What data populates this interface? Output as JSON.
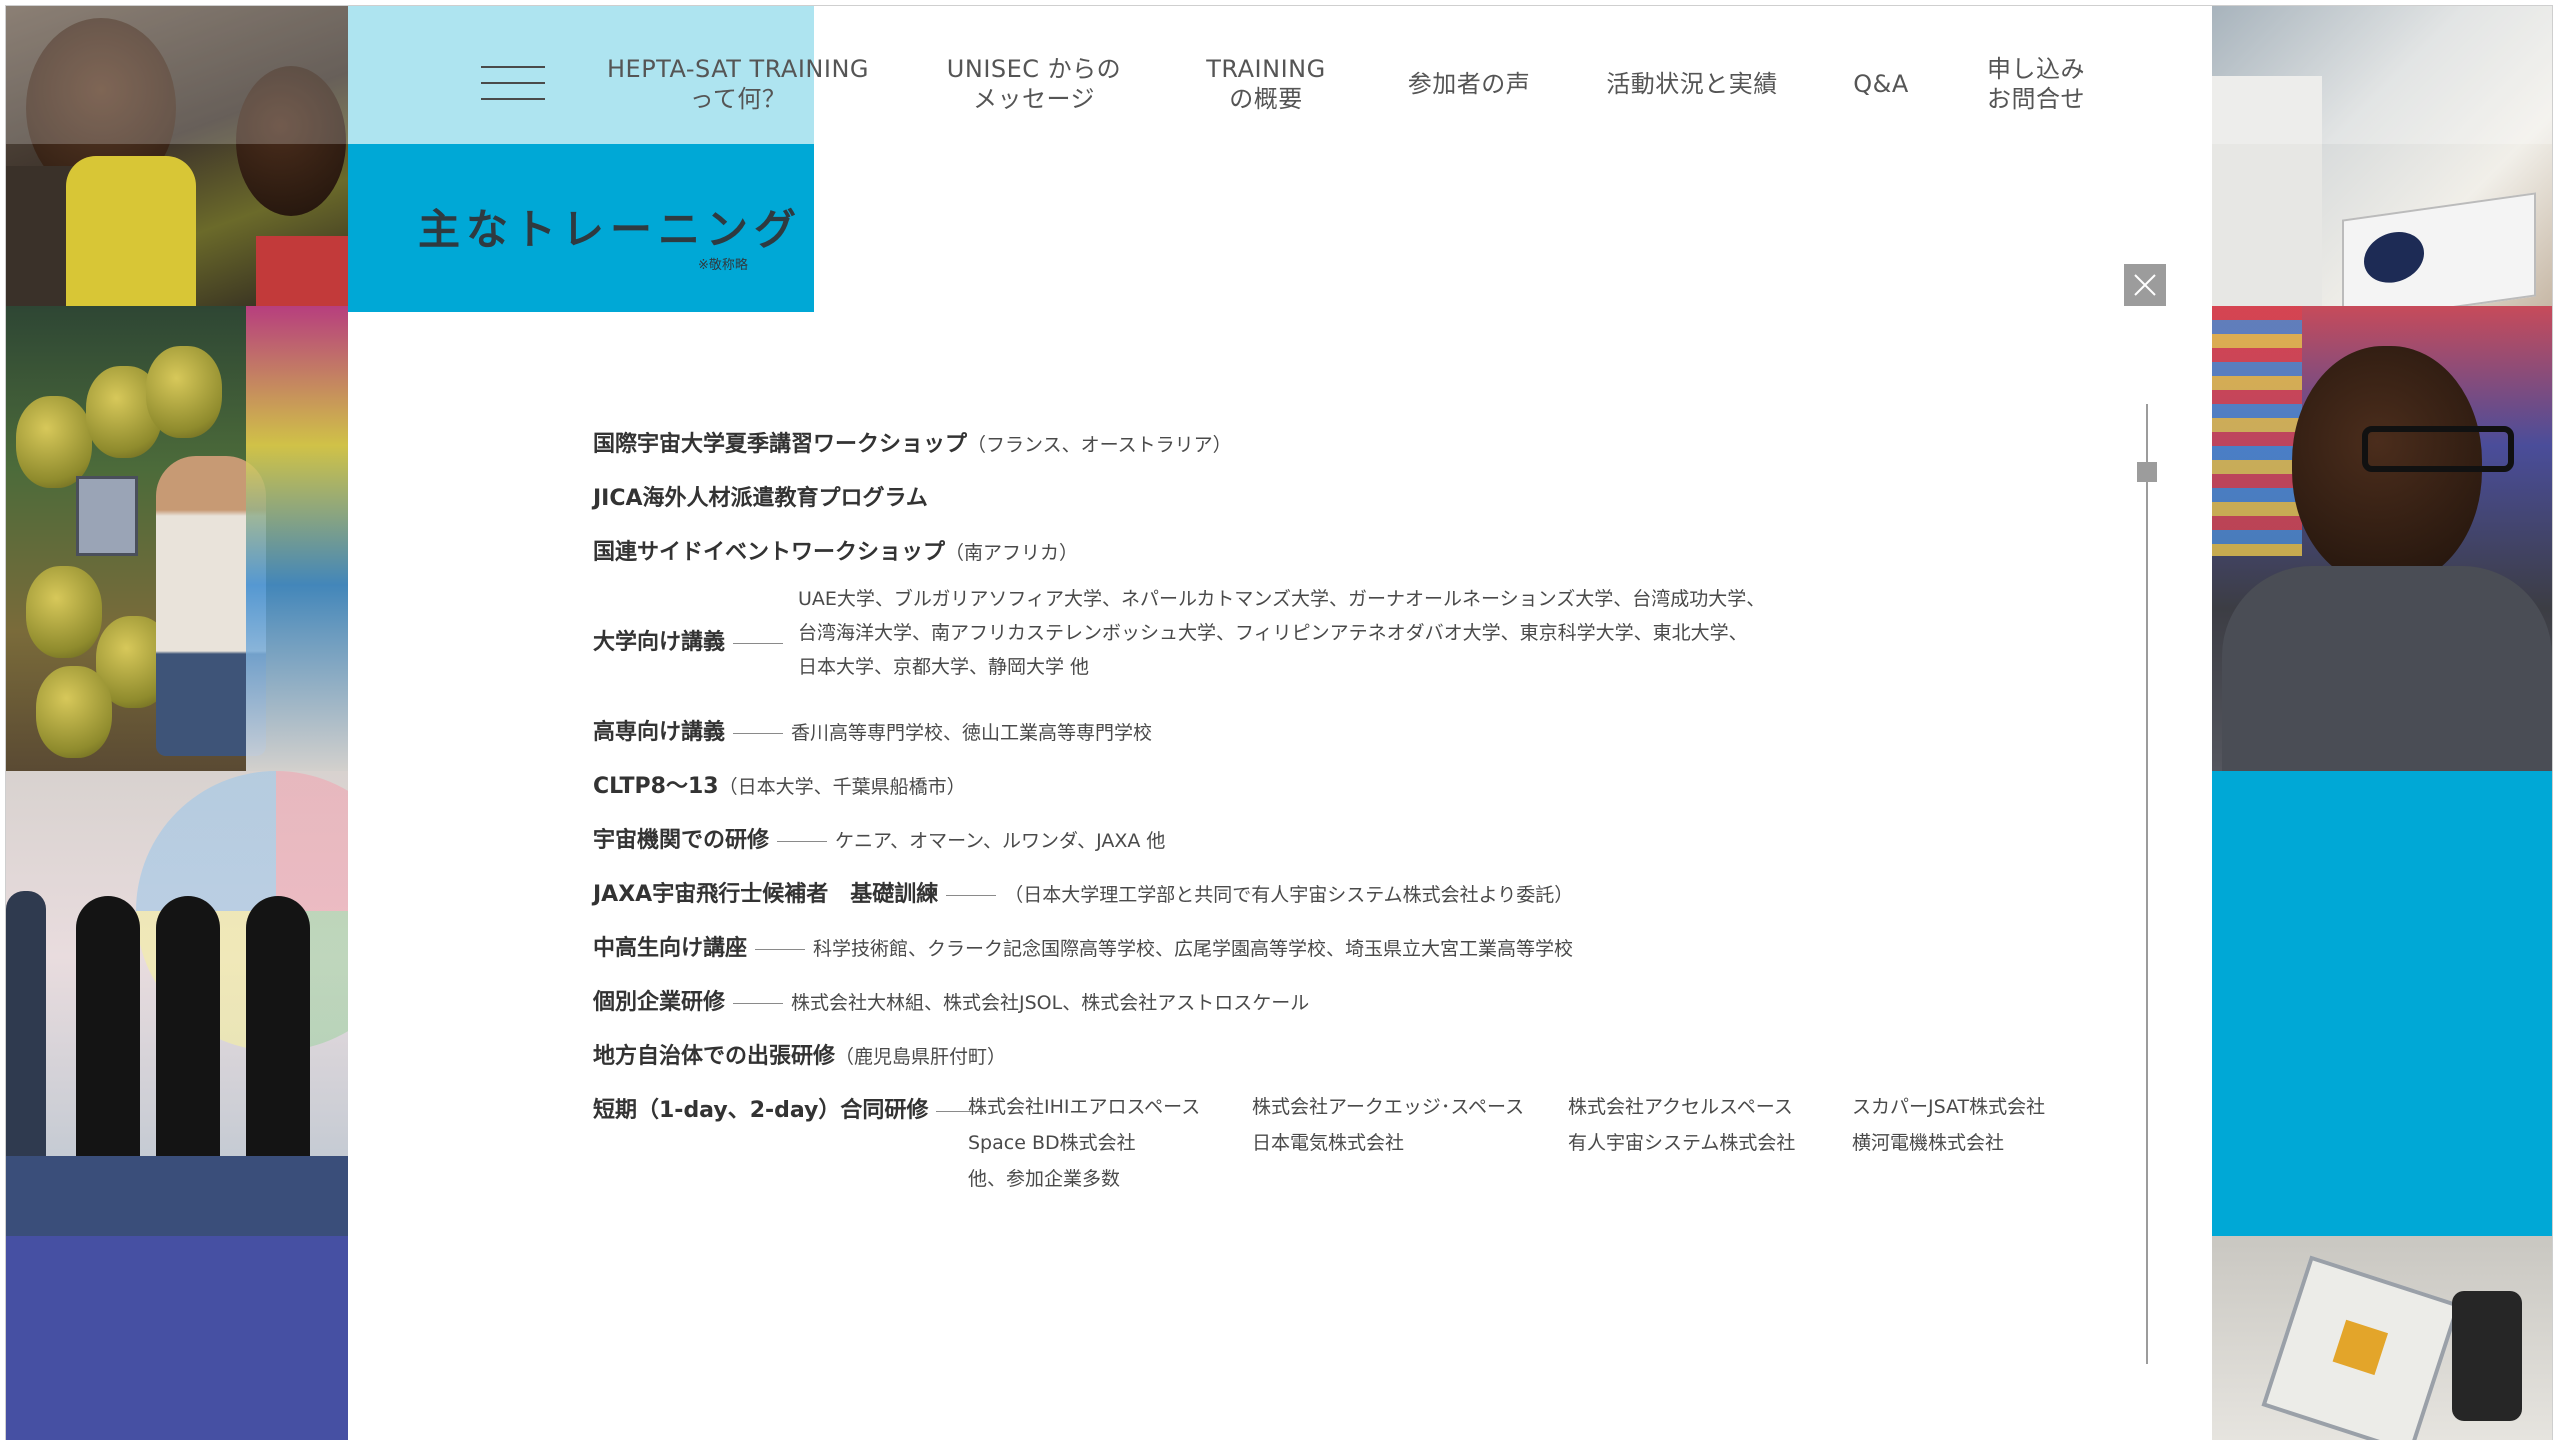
{
  "nav": {
    "items": [
      {
        "line1": "HEPTA-SAT TRAINING",
        "line2": "って何？"
      },
      {
        "line1": "UNISEC からの",
        "line2": "メッセージ"
      },
      {
        "line1": "TRAINING",
        "line2": "の概要"
      },
      {
        "line1": "参加者の声",
        "line2": ""
      },
      {
        "line1": "活動状況と実績",
        "line2": ""
      },
      {
        "line1": "Q&A",
        "line2": ""
      },
      {
        "line1": "申し込み",
        "line2": "お問合せ"
      }
    ]
  },
  "page": {
    "title": "主なトレーニング",
    "note": "※敬称略"
  },
  "trainings": [
    {
      "label": "国際宇宙大学夏季講習ワークショップ",
      "detail": "（フランス、オーストラリア）"
    },
    {
      "label": "JICA海外人材派遣教育プログラム",
      "detail": ""
    },
    {
      "label": "国連サイドイベントワークショップ",
      "detail": "（南アフリカ）"
    },
    {
      "label": "大学向け講義",
      "lines": [
        "UAE大学、ブルガリアソフィア大学、ネパールカトマンズ大学、ガーナオールネーションズ大学、台湾成功大学、",
        "台湾海洋大学、南アフリカステレンボッシュ大学、フィリピンアテネオダバオ大学、東京科学大学、東北大学、",
        "日本大学、京都大学、静岡大学 他"
      ]
    },
    {
      "label": "高専向け講義",
      "detail": "香川高等専門学校、徳山工業高等専門学校"
    },
    {
      "label": "CLTP8〜13",
      "detail": "（日本大学、千葉県船橋市）"
    },
    {
      "label": "宇宙機関での研修",
      "detail": "ケニア、オマーン、ルワンダ、JAXA 他"
    },
    {
      "label": "JAXA宇宙飛行士候補者　基礎訓練",
      "detail": "（日本大学理工学部と共同で有人宇宙システム株式会社より委託）"
    },
    {
      "label": "中高生向け講座",
      "detail": "科学技術館、クラーク記念国際高等学校、広尾学園高等学校、埼玉県立大宮工業高等学校"
    },
    {
      "label": "個別企業研修",
      "detail": "株式会社大林組、株式会社JSOL、株式会社アストロスケール"
    },
    {
      "label": "地方自治体での出張研修",
      "detail": "（鹿児島県肝付町）"
    },
    {
      "label": "短期（1-day、2-day）合同研修",
      "companies": [
        [
          "株式会社IHIエアロスペース",
          "株式会社アークエッジ･スペース",
          "株式会社アクセルスペース",
          "スカパーJSAT株式会社"
        ],
        [
          "Space BD株式会社",
          "日本電気株式会社",
          "有人宇宙システム株式会社",
          "横河電機株式会社"
        ],
        [
          "他、参加企業多数"
        ]
      ]
    }
  ],
  "colors": {
    "accent_light": "#aee4f0",
    "accent": "#00a8d6",
    "indigo": "#4650a3",
    "gray_control": "#9c9c9c"
  },
  "icons": {
    "menu": "hamburger-icon",
    "close": "close-icon"
  }
}
